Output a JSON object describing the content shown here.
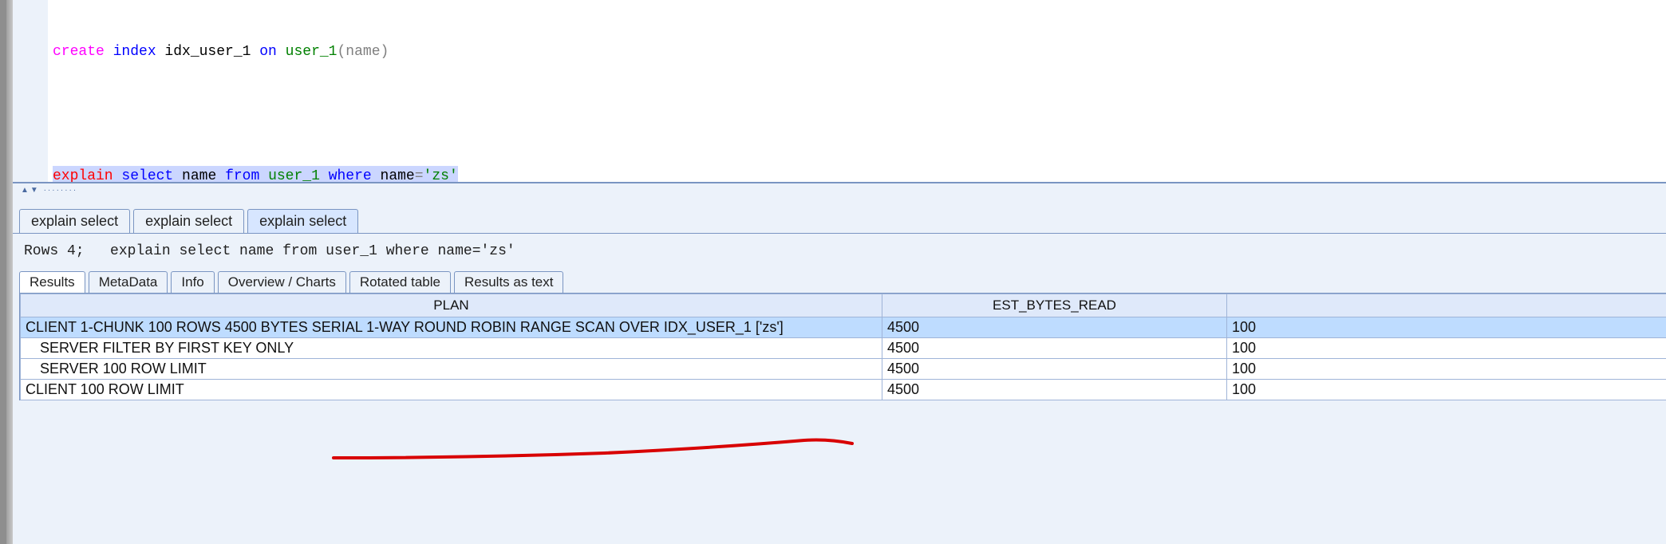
{
  "code": {
    "line1": {
      "t1": "create",
      "t2": " index",
      "t3": " idx_user_1 ",
      "t4": "on",
      "t5": " user_1",
      "t6": "(name)"
    },
    "line3": {
      "t1": "explain",
      "t2": " select",
      "t3": " name ",
      "t4": "from",
      "t5": " user_1 ",
      "t6": "where",
      "t7": " name",
      "t8": "=",
      "t9": "'zs'"
    }
  },
  "topTabs": [
    "explain select",
    "explain select",
    "explain select"
  ],
  "status": {
    "rows": "Rows 4;",
    "query": "explain select name from user_1 where name='zs'"
  },
  "subTabs": [
    "Results",
    "MetaData",
    "Info",
    "Overview / Charts",
    "Rotated table",
    "Results as text"
  ],
  "columns": [
    "PLAN",
    "EST_BYTES_READ",
    ""
  ],
  "rows": [
    {
      "plan": "CLIENT 1-CHUNK 100 ROWS 4500 BYTES SERIAL 1-WAY ROUND ROBIN RANGE SCAN OVER IDX_USER_1 ['zs']",
      "ebr": "4500",
      "c3": "100",
      "selected": true,
      "indent": 0
    },
    {
      "plan": "SERVER FILTER BY FIRST KEY ONLY",
      "ebr": "4500",
      "c3": "100",
      "selected": false,
      "indent": 1
    },
    {
      "plan": "SERVER 100 ROW LIMIT",
      "ebr": "4500",
      "c3": "100",
      "selected": false,
      "indent": 1
    },
    {
      "plan": "CLIENT 100 ROW LIMIT",
      "ebr": "4500",
      "c3": "100",
      "selected": false,
      "indent": 0
    }
  ]
}
